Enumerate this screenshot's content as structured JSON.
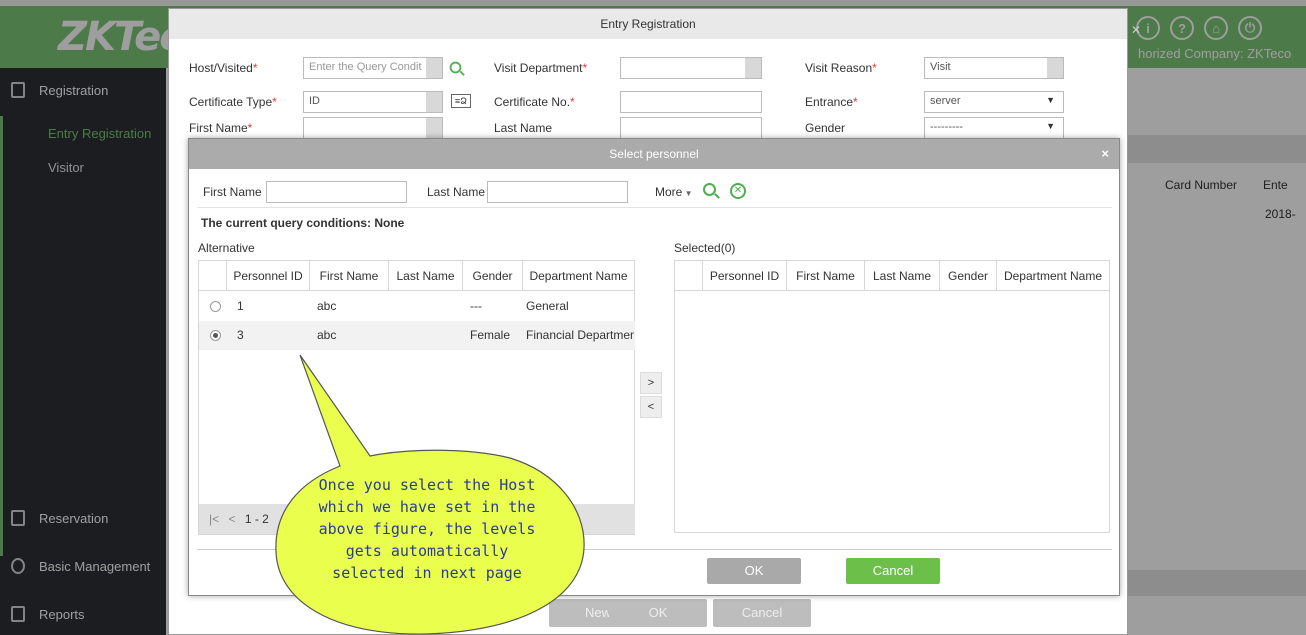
{
  "brand": {
    "logo": "ZKTeco",
    "company": "horized Company: ZKTeco"
  },
  "topbar": {
    "icons": [
      "info-icon",
      "help-icon",
      "user-icon",
      "power-icon"
    ],
    "icon_glyphs": [
      "i",
      "?",
      "⌂",
      "⏻"
    ]
  },
  "sidebar": {
    "registration": "Registration",
    "entry_registration": "Entry Registration",
    "visitor": "Visitor",
    "reservation": "Reservation",
    "basic_management": "Basic Management",
    "reports": "Reports"
  },
  "background_table": {
    "col_card": "Card Number",
    "col_enter": "Ente",
    "cell_date": "2018-"
  },
  "entry_dialog": {
    "title": "Entry Registration",
    "host_label": "Host/Visited",
    "host_placeholder": "Enter the Query Condit",
    "visit_department_label": "Visit Department",
    "visit_reason_label": "Visit Reason",
    "visit_reason_value": "Visit",
    "certificate_type_label": "Certificate Type",
    "certificate_type_value": "ID",
    "certificate_no_label": "Certificate No.",
    "entrance_label": "Entrance",
    "entrance_value": "server",
    "first_name_label": "First Name",
    "last_name_label": "Last Name",
    "gender_label": "Gender",
    "gender_value": "---------",
    "buttons": {
      "new": "New",
      "ok": "OK",
      "cancel": "Cancel"
    }
  },
  "select_dialog": {
    "title": "Select personnel",
    "first_name_label": "First Name",
    "last_name_label": "Last Name",
    "more_label": "More",
    "query_conditions": "The current query conditions:",
    "query_value": "None",
    "alternative_label": "Alternative",
    "selected_label": "Selected(0)",
    "columns": [
      "Personnel ID",
      "First Name",
      "Last Name",
      "Gender",
      "Department Name"
    ],
    "rows": [
      {
        "id": "1",
        "first_name": "abc",
        "last_name": "",
        "gender": "---",
        "department": "General",
        "checked": false
      },
      {
        "id": "3",
        "first_name": "abc",
        "last_name": "",
        "gender": "Female",
        "department": "Financial Department",
        "checked": true
      }
    ],
    "pager_text": "1 - 2",
    "move_right": ">",
    "move_left": "<",
    "ok": "OK",
    "cancel": "Cancel"
  },
  "callout": {
    "lines": [
      "Once you select the Host",
      "which we have set in the",
      "above figure, the levels",
      "gets automatically",
      "selected in next page"
    ],
    "fill": "#eaff4d"
  }
}
